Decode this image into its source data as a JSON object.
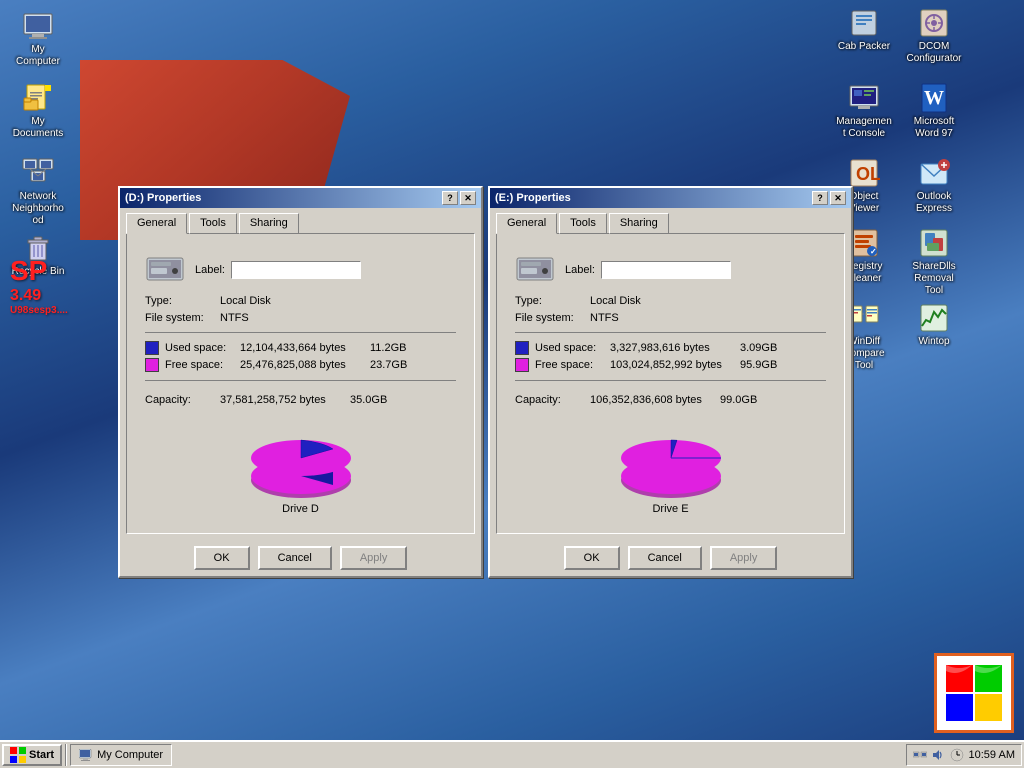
{
  "desktop": {
    "icons_left": [
      {
        "id": "my-computer",
        "label": "My Computer",
        "icon": "computer"
      },
      {
        "id": "my-documents",
        "label": "My Documents",
        "icon": "documents"
      },
      {
        "id": "network-neighborhood",
        "label": "Network Neighborhood",
        "icon": "network"
      },
      {
        "id": "recycle-bin",
        "label": "Recycle Bin",
        "icon": "recycle"
      }
    ],
    "icons_right": [
      {
        "id": "cab-packer",
        "label": "Cab Packer",
        "icon": "cab"
      },
      {
        "id": "dcom-configurator",
        "label": "DCOM Configurator",
        "icon": "dcom"
      },
      {
        "id": "management-console",
        "label": "Management Console",
        "icon": "management"
      },
      {
        "id": "microsoft-word",
        "label": "Microsoft Word 97",
        "icon": "word"
      },
      {
        "id": "object-viewer",
        "label": "Object Viewer",
        "icon": "object"
      },
      {
        "id": "outlook-express",
        "label": "Outlook Express",
        "icon": "outlook"
      },
      {
        "id": "registry-cleaner",
        "label": "Registry Cleaner",
        "icon": "registry"
      },
      {
        "id": "sharedlls",
        "label": "ShareDlls Removal Tool",
        "icon": "sharedlls"
      },
      {
        "id": "windiff",
        "label": "WinDiff Compare Tool",
        "icon": "windiff"
      },
      {
        "id": "wintop",
        "label": "Wintop",
        "icon": "wintop"
      }
    ],
    "sp_label": "SP",
    "sp_version": "3.49",
    "sp_file": "U98sesp3...."
  },
  "dialog_d": {
    "title": "(D:) Properties",
    "tabs": [
      "General",
      "Tools",
      "Sharing"
    ],
    "active_tab": "General",
    "label_text": "Label:",
    "label_value": "",
    "type_label": "Type:",
    "type_value": "Local Disk",
    "filesystem_label": "File system:",
    "filesystem_value": "NTFS",
    "used_label": "Used space:",
    "used_bytes": "12,104,433,664 bytes",
    "used_size": "11.2GB",
    "free_label": "Free space:",
    "free_bytes": "25,476,825,088 bytes",
    "free_size": "23.7GB",
    "capacity_label": "Capacity:",
    "capacity_bytes": "37,581,258,752 bytes",
    "capacity_size": "35.0GB",
    "drive_label": "Drive D",
    "used_color": "#2020c0",
    "free_color": "#e020e0",
    "buttons": {
      "ok": "OK",
      "cancel": "Cancel",
      "apply": "Apply"
    },
    "used_percent": 32,
    "free_percent": 68
  },
  "dialog_e": {
    "title": "(E:) Properties",
    "tabs": [
      "General",
      "Tools",
      "Sharing"
    ],
    "active_tab": "General",
    "label_text": "Label:",
    "label_value": "",
    "type_label": "Type:",
    "type_value": "Local Disk",
    "filesystem_label": "File system:",
    "filesystem_value": "NTFS",
    "used_label": "Used space:",
    "used_bytes": "3,327,983,616 bytes",
    "used_size": "3.09GB",
    "free_label": "Free space:",
    "free_bytes": "103,024,852,992 bytes",
    "free_size": "95.9GB",
    "capacity_label": "Capacity:",
    "capacity_bytes": "106,352,836,608 bytes",
    "capacity_size": "99.0GB",
    "drive_label": "Drive E",
    "used_color": "#2020c0",
    "free_color": "#e020e0",
    "buttons": {
      "ok": "OK",
      "cancel": "Cancel",
      "apply": "Apply"
    },
    "used_percent": 3,
    "free_percent": 97
  },
  "taskbar": {
    "start_label": "Start",
    "items": [
      {
        "label": "My Computer",
        "icon": "computer"
      }
    ],
    "tray_icons": [
      "network",
      "volume",
      "clock"
    ],
    "time": "10:59 AM"
  }
}
